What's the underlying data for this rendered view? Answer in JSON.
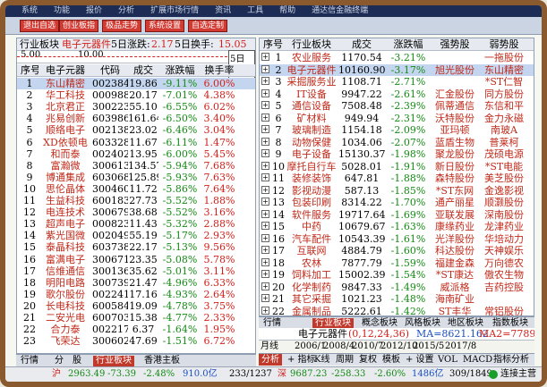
{
  "menubar": [
    "系统",
    "功能",
    "报价",
    "分析",
    "扩展市场行情",
    "资讯",
    "工具",
    "帮助",
    "通达信金融终端"
  ],
  "toolbar": [
    "退出自选",
    "创业板指",
    "极品走势",
    "系统设置",
    "自选定制"
  ],
  "left": {
    "tab_label": "行业板块",
    "board_name": "电子元器件",
    "day5_label": "5日涨跌:",
    "day5_value": "2.17",
    "turnover_label": "5日换手:",
    "turnover_value": "15.05",
    "columns": [
      "序号",
      "电子元器",
      "代码",
      "成交",
      "涨跌幅",
      "换手率"
    ],
    "rows": [
      [
        "1",
        "东山精密",
        "002384",
        "19.86",
        "-9.11%",
        "6.00%"
      ],
      [
        "2",
        "华工科技",
        "000988",
        "20.17",
        "-7.01%",
        "4.38%"
      ],
      [
        "3",
        "北京君正",
        "300223",
        "55.10",
        "-6.55%",
        "6.02%"
      ],
      [
        "4",
        "兆易创新",
        "603986",
        "161.64",
        "-6.50%",
        "3.40%"
      ],
      [
        "5",
        "顺络电子",
        "002138",
        "23.02",
        "-6.46%",
        "3.04%"
      ],
      [
        "6",
        "XD依顿电",
        "603328",
        "11.67",
        "-6.11%",
        "1.47%"
      ],
      [
        "7",
        "和而泰",
        "002402",
        "13.95",
        "-6.00%",
        "5.45%"
      ],
      [
        "8",
        "富瀚微",
        "300613",
        "134.57",
        "-5.94%",
        "7.68%"
      ],
      [
        "9",
        "博通集成",
        "603068",
        "125.89",
        "-5.93%",
        "7.63%"
      ],
      [
        "10",
        "思伦晶体",
        "300460",
        "11.72",
        "-5.86%",
        "7.64%"
      ],
      [
        "11",
        "生益科技",
        "600183",
        "27.73",
        "-5.52%",
        "1.88%"
      ],
      [
        "12",
        "电连技术",
        "300679",
        "38.68",
        "-5.52%",
        "3.16%"
      ],
      [
        "13",
        "超声电子",
        "000823",
        "11.43",
        "-5.32%",
        "2.88%"
      ],
      [
        "14",
        "紫光国微",
        "002049",
        "55.19",
        "-5.17%",
        "2.93%"
      ],
      [
        "15",
        "泰晶科技",
        "603738",
        "22.17",
        "-5.13%",
        "9.56%"
      ],
      [
        "16",
        "富满电子",
        "300671",
        "23.35",
        "-5.08%",
        "5.78%"
      ],
      [
        "17",
        "信维通信",
        "300136",
        "35.62",
        "-5.01%",
        "3.11%"
      ],
      [
        "18",
        "明阳电路",
        "300739",
        "21.47",
        "-4.96%",
        "6.33%"
      ],
      [
        "19",
        "歌尔股份",
        "002241",
        "17.16",
        "-4.93%",
        "2.64%"
      ],
      [
        "20",
        "长电科技",
        "600584",
        "19.09",
        "-4.78%",
        "3.75%"
      ],
      [
        "21",
        "二安光电",
        "600703",
        "15.38",
        "-4.77%",
        "2.33%"
      ],
      [
        "22",
        "合力泰",
        "002217",
        "6.37",
        "-1.64%",
        "1.95%"
      ],
      [
        "23",
        "飞荣达",
        "300602",
        "47.69",
        "-1.51%",
        "6.72%"
      ]
    ],
    "tabs": [
      "行情",
      "分",
      "股",
      "行业板块",
      "香港主板"
    ]
  },
  "right": {
    "columns": [
      "序号",
      "行业板块",
      "成交",
      "涨跌幅",
      "强势股",
      "弱势股"
    ],
    "rows": [
      [
        "1",
        "农业服务",
        "1170.54",
        "-3.21%",
        "",
        "一拖股份"
      ],
      [
        "2",
        "电子元器件",
        "10160.90",
        "-3.17%",
        "旭光股份",
        "东山精密"
      ],
      [
        "3",
        "采掘服务业",
        "1108.71",
        "-2.71%",
        "",
        "*ST仁智"
      ],
      [
        "4",
        "IT设备",
        "9947.22",
        "-2.61%",
        "汇金股份",
        "同方股份"
      ],
      [
        "5",
        "通信设备",
        "7508.48",
        "-2.39%",
        "佩蒂通信",
        "东信和平"
      ],
      [
        "6",
        "矿材料",
        "949.94",
        "-2.31%",
        "沃特股份",
        "金力永磁"
      ],
      [
        "7",
        "玻璃制造",
        "1154.18",
        "-2.09%",
        "亚玛顿",
        "南玻A"
      ],
      [
        "8",
        "动物保健",
        "1034.06",
        "-2.07%",
        "蓝盾生物",
        "普莱柯"
      ],
      [
        "9",
        "电子设备",
        "15130.37",
        "-1.98%",
        "聚龙股份",
        "茂硕电源"
      ],
      [
        "10",
        "摩托自行车",
        "5028.01",
        "-1.91%",
        "新日股份",
        "*ST电能"
      ],
      [
        "11",
        "装修装饰",
        "647.81",
        "-1.88%",
        "森特股份",
        "美芝股份"
      ],
      [
        "12",
        "影视动漫",
        "587.13",
        "-1.85%",
        "*ST东网",
        "金逸影视"
      ],
      [
        "13",
        "包装印刷",
        "8314.22",
        "-1.70%",
        "通产丽星",
        "顺灏股份"
      ],
      [
        "14",
        "软件服务",
        "19717.64",
        "-1.69%",
        "亚联发展",
        "深南股份"
      ],
      [
        "15",
        "中药",
        "10679.67",
        "-1.63%",
        "康缘药业",
        "龙津药业"
      ],
      [
        "16",
        "汽车配件",
        "10543.39",
        "-1.61%",
        "光洋股份",
        "华培动力"
      ],
      [
        "17",
        "互联网",
        "4884.79",
        "-1.60%",
        "科达股份",
        "天神娱乐"
      ],
      [
        "18",
        "农林",
        "7877.79",
        "-1.59%",
        "福建金森",
        "万向德农"
      ],
      [
        "19",
        "饲料加工",
        "15002.39",
        "-1.54%",
        "*ST康达",
        "傲农生物"
      ],
      [
        "20",
        "化学制药",
        "9847.33",
        "-1.49%",
        "威派格",
        "吉药控股"
      ],
      [
        "21",
        "其它采掘",
        "1021.23",
        "-1.48%",
        "海南矿业",
        ""
      ],
      [
        "22",
        "金属制品",
        "5222.61",
        "-1.42%",
        "ST丰华",
        "常铝股份"
      ]
    ],
    "tabs": [
      "行情",
      "行业板块",
      "概念板块",
      "风格板块",
      "地区板块",
      "指数板块"
    ]
  },
  "info": {
    "name": "电子元器件",
    "mini_values": [
      "0",
      "12",
      "24",
      "36"
    ],
    "ma_label": "MA=8621.162",
    "ma2_label": "MA2=7789.94",
    "month_label": "月线",
    "years": [
      "2006/1",
      "2008/4",
      "2010/7",
      "2012/10",
      "2015/5",
      "2017/8"
    ]
  },
  "bottombar": [
    "分析",
    "+ 指标",
    "K线",
    "周期",
    "复权",
    "模板",
    "+ 设置",
    "VOL",
    "MACD",
    "指标分析"
  ],
  "status": {
    "sh_label": "沪",
    "sh_value": "2963.49",
    "sh_change": "-73.39",
    "sh_pct": "-2.48%",
    "sh_amt": "910.0亿",
    "sh_ud": "233/1237",
    "sz_label": "深",
    "sz_value": "9687.23",
    "sz_change": "-258.33",
    "sz_pct": "-2.60%",
    "sz_amt": "1486亿",
    "sz_ud": "309/1849",
    "conn": "连接主营"
  }
}
